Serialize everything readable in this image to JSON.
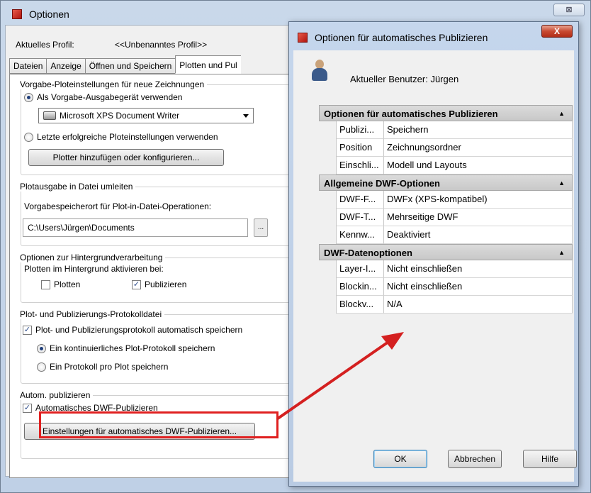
{
  "window": {
    "title": "Optionen",
    "close_label": "⊠"
  },
  "profile": {
    "label": "Aktuelles Profil:",
    "value": "<<Unbenanntes Profil>>"
  },
  "tabs": [
    {
      "label": "Dateien"
    },
    {
      "label": "Anzeige"
    },
    {
      "label": "Öffnen und Speichern"
    },
    {
      "label": "Plotten und Pul"
    }
  ],
  "plot_defaults": {
    "title": "Vorgabe-Ploteinstellungen für neue Zeichnungen",
    "option_default_device": "Als Vorgabe-Ausgabegerät verwenden",
    "device_value": "Microsoft XPS Document Writer",
    "option_last_settings": "Letzte erfolgreiche Ploteinstellungen verwenden",
    "add_plotter_button": "Plotter hinzufügen oder konfigurieren..."
  },
  "plot_to_file": {
    "title": "Plotausgabe in Datei umleiten",
    "location_label": "Vorgabespeicherort für Plot-in-Datei-Operationen:",
    "location_value": "C:\\Users\\Jürgen\\Documents",
    "browse_label": "..."
  },
  "background": {
    "title": "Optionen zur Hintergrundverarbeitung",
    "enable_label": "Plotten im Hintergrund aktivieren bei:",
    "plot_label": "Plotten",
    "publish_label": "Publizieren"
  },
  "log": {
    "title": "Plot- und Publizierungs-Protokolldatei",
    "auto_save_label": "Plot- und Publizierungsprotokoll automatisch speichern",
    "continuous_label": "Ein kontinuierliches Plot-Protokoll speichern",
    "per_plot_label": "Ein Protokoll pro Plot speichern"
  },
  "auto_publish": {
    "title": "Autom. publizieren",
    "checkbox_label": "Automatisches DWF-Publizieren",
    "settings_button": "Einstellungen für automatisches DWF-Publizieren..."
  },
  "dialog": {
    "title": "Optionen für automatisches Publizieren",
    "close_label": "X",
    "user_label": "Aktueller Benutzer: Jürgen",
    "categories": [
      {
        "name": "Optionen für automatisches Publizieren",
        "props": [
          {
            "key": "Publizi...",
            "value": "Speichern"
          },
          {
            "key": "Position",
            "value": "Zeichnungsordner"
          },
          {
            "key": "Einschli...",
            "value": "Modell und Layouts"
          }
        ]
      },
      {
        "name": "Allgemeine DWF-Optionen",
        "props": [
          {
            "key": "DWF-F...",
            "value": "DWFx (XPS-kompatibel)"
          },
          {
            "key": "DWF-T...",
            "value": "Mehrseitige DWF"
          },
          {
            "key": "Kennw...",
            "value": "Deaktiviert"
          }
        ]
      },
      {
        "name": "DWF-Datenoptionen",
        "props": [
          {
            "key": "Layer-I...",
            "value": "Nicht einschließen"
          },
          {
            "key": "Blockin...",
            "value": "Nicht einschließen"
          },
          {
            "key": "Blockv...",
            "value": "N/A"
          }
        ]
      }
    ],
    "ok_label": "OK",
    "cancel_label": "Abbrechen",
    "help_label": "Hilfe"
  },
  "colors": {
    "highlight": "#e02020",
    "arrow": "#d42020"
  }
}
